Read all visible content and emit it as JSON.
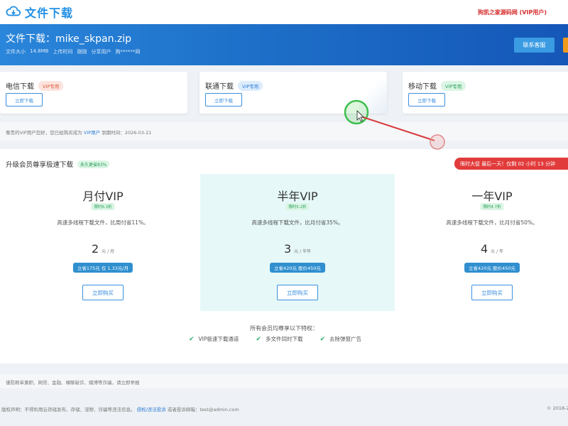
{
  "brand": {
    "title": "文件下载"
  },
  "top_user": "狗凯之家源码网 (VIP用户)",
  "file": {
    "title": "文件下载：mike_skpan.zip",
    "size_label": "文件大小",
    "size_value": "14.8MB",
    "upload_label": "上传时间",
    "upload_value": "刚刚",
    "share_label": "分享用户",
    "share_value": "购******网"
  },
  "header_buttons": {
    "contact": "联系客服"
  },
  "download_cards": [
    {
      "title": "电信下载",
      "tag": "VIP专用",
      "button": "立即下载"
    },
    {
      "title": "联通下载",
      "tag": "VIP专用",
      "button": "立即下载"
    },
    {
      "title": "移动下载",
      "tag": "VIP专用",
      "button": "立即下载"
    }
  ],
  "notice": {
    "prefix": "尊贵的VIP用户您好，您已经购买成为",
    "vip": "VIP用户",
    "suffix": "到期时间：2026-03-21"
  },
  "vip_section": {
    "title": "升级会员尊享极速下载",
    "save_badge": "永久更省83%",
    "promo": "限时大促 最后一天！仅剩 02 小时 13 分钟"
  },
  "plans": [
    {
      "name": "月付VIP",
      "discount": "限时6.3折",
      "desc": "高速多线程下载文件，比周付省11%。",
      "price": "2",
      "unit": "元 / 月",
      "save": "立省175元 仅 1.33元/月",
      "buy": "立即购买"
    },
    {
      "name": "半年VIP",
      "discount": "限时5.2折",
      "desc": "高速多线程下载文件，比月付省35%。",
      "price": "3",
      "unit": "元 / 半年",
      "save": "立省420元 股价450元",
      "buy": "立即购买"
    },
    {
      "name": "一年VIP",
      "discount": "限时4.7折",
      "desc": "高速多线程下载文件，比月付省50%。",
      "price": "4",
      "unit": "元 / 年",
      "save": "立省420元 股价450元",
      "buy": "立即购买"
    }
  ],
  "privileges": {
    "title": "所有会员均尊享以下特权：",
    "items": [
      "VIP极速下载通道",
      "多文件同时下载",
      "去除弹窗广告"
    ]
  },
  "warning": "谨防刷单兼职、网贷、金融、裸聊敲诈、赌博等诈骗，请立即举报",
  "footer": {
    "prefix": "版权声明：不得利用云存储发布、存储、淫秽、诈骗等违法信息。",
    "link": "侵权/违法投诉",
    "suffix": "或者投诉邮箱：test@admin.com",
    "copyright": "© 2018-2"
  },
  "colors": {
    "brand_blue": "#1e8fe6",
    "header_blue": "#1d6fc8",
    "promo_red": "#e23b3b",
    "accent_green": "#28a05a"
  }
}
